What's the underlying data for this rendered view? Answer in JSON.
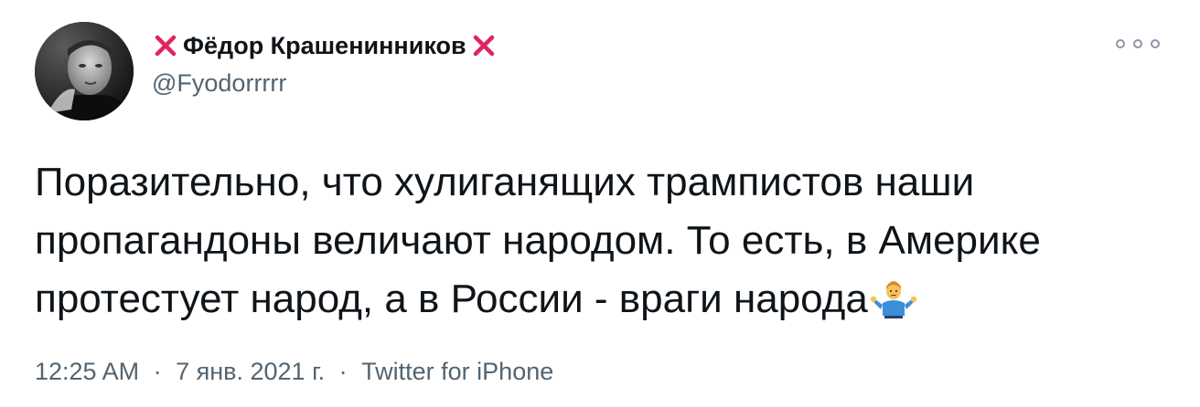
{
  "author": {
    "display_name": "Фёдор Крашенинников",
    "handle": "@Fyodorrrrr",
    "name_decoration": "cross-mark-icon",
    "avatar_icon": "profile-photo"
  },
  "tweet": {
    "lines": [
      "Поразительно, что хулиганящих трампистов наши",
      "пропагандоны величают народом. То есть, в Америке",
      "протестует народ, а в России - враги народа"
    ],
    "trailing_emoji": "person-shrugging-emoji"
  },
  "meta": {
    "time": "12:25 AM",
    "date": "7 янв. 2021 г.",
    "source": "Twitter for iPhone",
    "separator": "·"
  },
  "actions": {
    "more_icon": "more-options-icon"
  },
  "colors": {
    "text_primary": "#0f1419",
    "text_secondary": "#536471",
    "cross_red": "#e0245e",
    "background": "#ffffff"
  }
}
